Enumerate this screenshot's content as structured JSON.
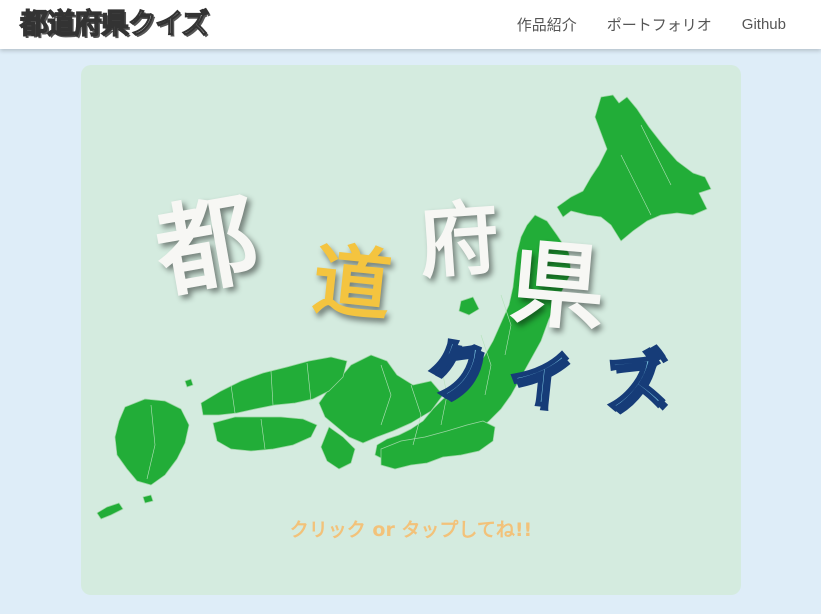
{
  "brand": {
    "chars": [
      "都",
      "道",
      "府",
      "県",
      "ク",
      "イ",
      "ズ"
    ]
  },
  "nav": {
    "items": [
      "作品紹介",
      "ポートフォリオ",
      "Github"
    ]
  },
  "hero": {
    "title_chars": [
      "都",
      "道",
      "府",
      "県"
    ],
    "quiz_chars": [
      "ク",
      "イ",
      "ズ"
    ],
    "cta": "クリック or タップしてね!!"
  },
  "colors": {
    "background": "#deedf8",
    "card": "#d4ebdf",
    "map_green": "#22ad38",
    "accent_orange": "#f2a93b",
    "title_yellow": "#f4c43f",
    "quiz_blue": "#7ec8e4",
    "quiz_outline": "#163c78",
    "cta_text": "#f2c27a"
  }
}
